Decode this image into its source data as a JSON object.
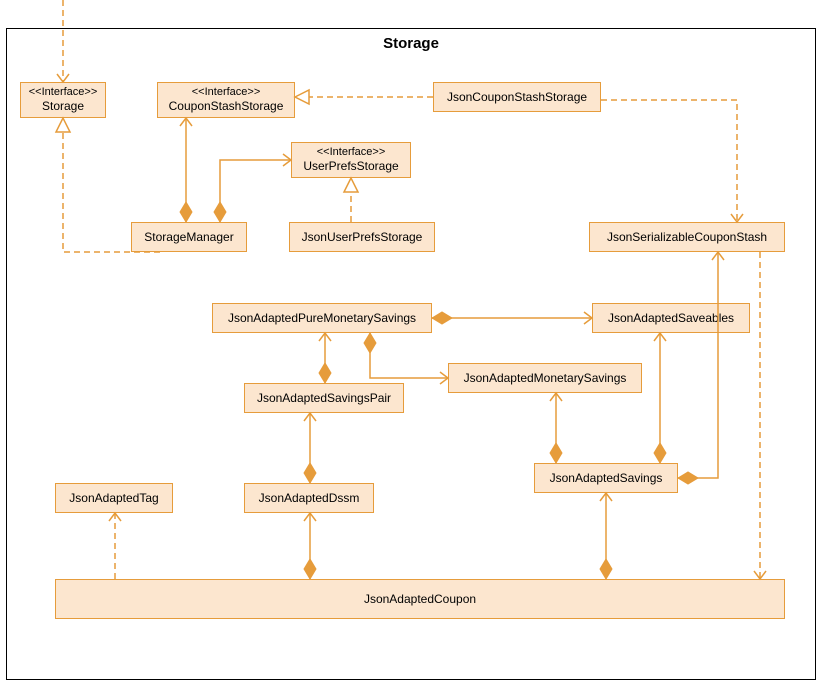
{
  "frame": {
    "title": "Storage"
  },
  "nodes": {
    "storage": {
      "stereo": "<<Interface>>",
      "name": "Storage"
    },
    "couponStashStorage": {
      "stereo": "<<Interface>>",
      "name": "CouponStashStorage"
    },
    "userPrefsStorage": {
      "stereo": "<<Interface>>",
      "name": "UserPrefsStorage"
    },
    "jsonCouponStashStorage": {
      "name": "JsonCouponStashStorage"
    },
    "storageManager": {
      "name": "StorageManager"
    },
    "jsonUserPrefsStorage": {
      "name": "JsonUserPrefsStorage"
    },
    "jsonSerializableCouponStash": {
      "name": "JsonSerializableCouponStash"
    },
    "japms": {
      "name": "JsonAdaptedPureMonetarySavings"
    },
    "jasave": {
      "name": "JsonAdaptedSaveables"
    },
    "jams": {
      "name": "JsonAdaptedMonetarySavings"
    },
    "jasp": {
      "name": "JsonAdaptedSavingsPair"
    },
    "jas": {
      "name": "JsonAdaptedSavings"
    },
    "jatag": {
      "name": "JsonAdaptedTag"
    },
    "jadssm": {
      "name": "JsonAdaptedDssm"
    },
    "jacoupon": {
      "name": "JsonAdaptedCoupon"
    }
  }
}
